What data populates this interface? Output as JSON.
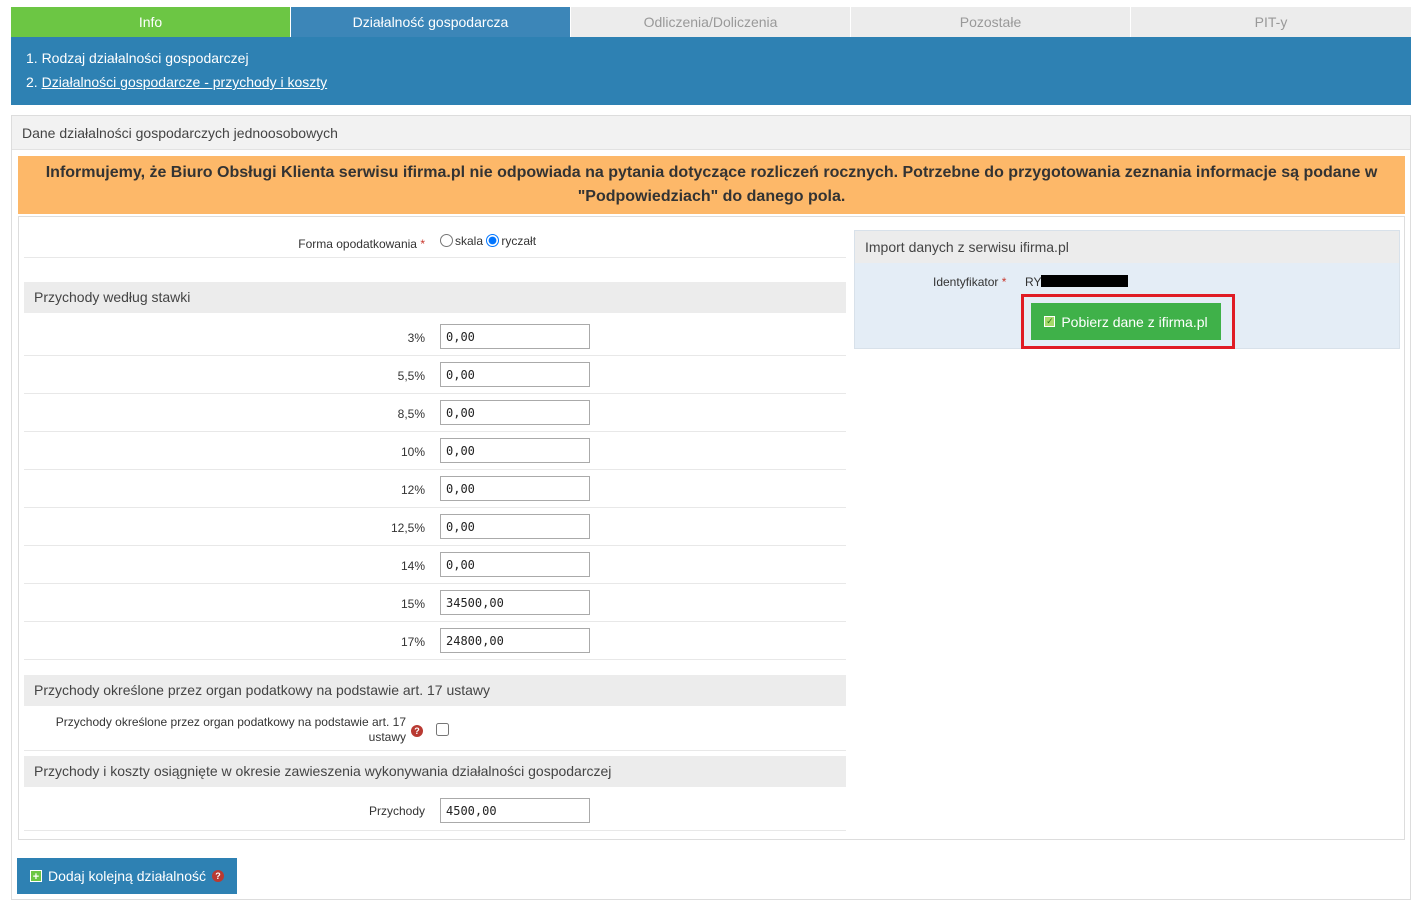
{
  "tabs": [
    {
      "label": "Info"
    },
    {
      "label": "Działalność gospodarcza"
    },
    {
      "label": "Odliczenia/Doliczenia"
    },
    {
      "label": "Pozostałe"
    },
    {
      "label": "PIT-y"
    }
  ],
  "steps": [
    {
      "label": "1. Rodzaj działalności gospodarczej"
    },
    {
      "prefix": "2. ",
      "label": "Działalności gospodarcze - przychody i koszty"
    }
  ],
  "panel": {
    "title": "Dane działalności gospodarczych jednoosobowych"
  },
  "notice": "Informujemy, że Biuro Obsługi Klienta serwisu ifirma.pl nie odpowiada na pytania dotyczące rozliczeń rocznych. Potrzebne do przygotowania zeznania informacje są podane w \"Podpowiedziach\" do danego pola.",
  "form": {
    "taxation_label": "Forma opodatkowania",
    "required_mark": "*",
    "radio_options": [
      "skala",
      "ryczałt"
    ],
    "radio_selected": "ryczałt",
    "rates_section": "Przychody według stawki",
    "rates": [
      {
        "label": "3%",
        "value": "0,00"
      },
      {
        "label": "5,5%",
        "value": "0,00"
      },
      {
        "label": "8,5%",
        "value": "0,00"
      },
      {
        "label": "10%",
        "value": "0,00"
      },
      {
        "label": "12%",
        "value": "0,00"
      },
      {
        "label": "12,5%",
        "value": "0,00"
      },
      {
        "label": "14%",
        "value": "0,00"
      },
      {
        "label": "15%",
        "value": "34500,00"
      },
      {
        "label": "17%",
        "value": "24800,00"
      }
    ],
    "art17_section": "Przychody określone przez organ podatkowy na podstawie art. 17 ustawy",
    "art17_label_line1": "Przychody określone przez organ podatkowy na podstawie art. 17",
    "art17_label_line2": "ustawy",
    "art17_checked": false,
    "suspension_section": "Przychody i koszty osiągnięte w okresie zawieszenia wykonywania działalności gospodarczej",
    "revenue_label": "Przychody",
    "revenue_value": "4500,00",
    "help_glyph": "?"
  },
  "import": {
    "title": "Import danych z serwisu ifirma.pl",
    "id_label": "Identyfikator",
    "id_prefix": "RY",
    "button_label": "Pobierz dane z ifirma.pl"
  },
  "add_button": {
    "label": "Dodaj kolejną działalność"
  },
  "colors": {
    "accent_blue": "#2e81b3",
    "green": "#6cc644",
    "button_green": "#3fb149",
    "notice": "#fdb869",
    "highlight": "#e01b24"
  }
}
